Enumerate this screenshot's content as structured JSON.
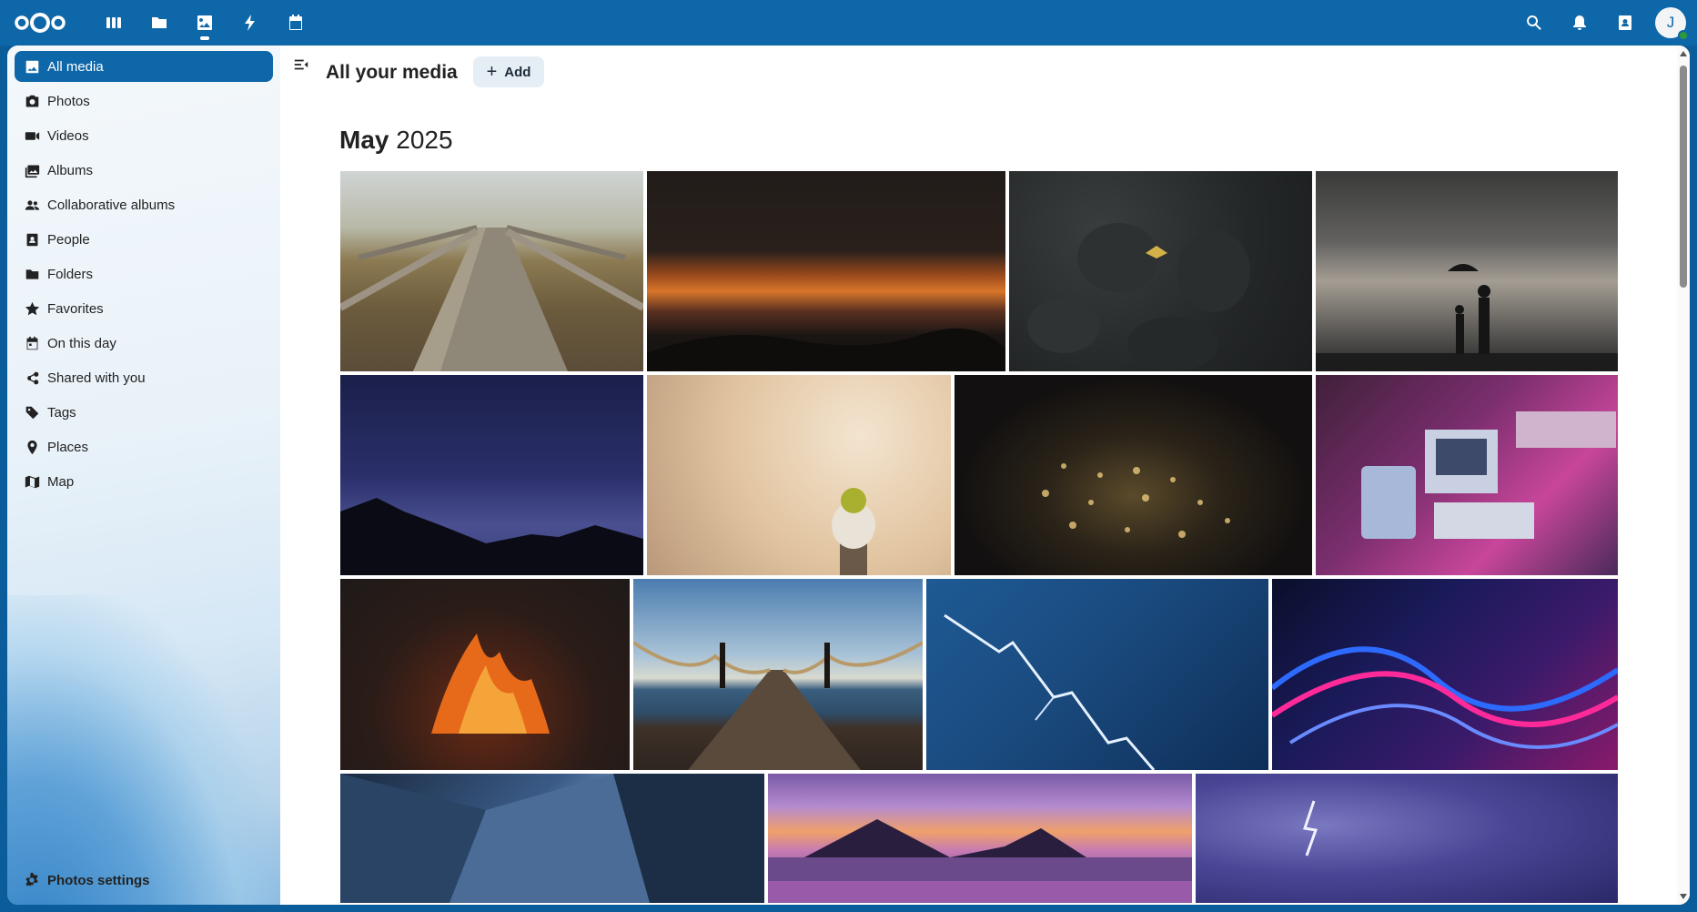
{
  "header": {
    "logo": "nextcloud-logo",
    "apps": [
      {
        "name": "dashboard",
        "icon": "dashboard-icon",
        "active": false
      },
      {
        "name": "files",
        "icon": "folder-icon",
        "active": false
      },
      {
        "name": "photos",
        "icon": "image-icon",
        "active": true
      },
      {
        "name": "activity",
        "icon": "lightning-icon",
        "active": false
      },
      {
        "name": "calendar",
        "icon": "calendar-icon",
        "active": false
      }
    ],
    "avatar_initial": "J",
    "accent": "#0e67a8"
  },
  "sidebar": {
    "items": [
      {
        "label": "All media",
        "icon": "image-icon",
        "active": true
      },
      {
        "label": "Photos",
        "icon": "camera-icon",
        "active": false
      },
      {
        "label": "Videos",
        "icon": "video-icon",
        "active": false
      },
      {
        "label": "Albums",
        "icon": "album-icon",
        "active": false
      },
      {
        "label": "Collaborative albums",
        "icon": "group-icon",
        "active": false
      },
      {
        "label": "People",
        "icon": "person-icon",
        "active": false
      },
      {
        "label": "Folders",
        "icon": "folder-icon",
        "active": false
      },
      {
        "label": "Favorites",
        "icon": "star-icon",
        "active": false
      },
      {
        "label": "On this day",
        "icon": "calendar-icon",
        "active": false
      },
      {
        "label": "Shared with you",
        "icon": "share-icon",
        "active": false
      },
      {
        "label": "Tags",
        "icon": "tag-icon",
        "active": false
      },
      {
        "label": "Places",
        "icon": "pin-icon",
        "active": false
      },
      {
        "label": "Map",
        "icon": "map-icon",
        "active": false
      }
    ],
    "settings_label": "Photos settings"
  },
  "main": {
    "title": "All your media",
    "add_label": "Add",
    "month_bold": "May",
    "month_year": "2025"
  },
  "photos": [
    {
      "name": "wooden-boardwalk"
    },
    {
      "name": "orange-sunset-clouds"
    },
    {
      "name": "moth-on-rocks"
    },
    {
      "name": "silhouette-umbrella"
    },
    {
      "name": "starry-mountain-night"
    },
    {
      "name": "yellow-bird-on-post"
    },
    {
      "name": "glittering-water-night"
    },
    {
      "name": "retro-computer-neon"
    },
    {
      "name": "campfire"
    },
    {
      "name": "pier-rope-sea"
    },
    {
      "name": "lightning-blue-sky"
    },
    {
      "name": "neon-light-waves"
    },
    {
      "name": "glass-building"
    },
    {
      "name": "purple-volcano-lake"
    },
    {
      "name": "storm-clouds-lightning"
    }
  ]
}
